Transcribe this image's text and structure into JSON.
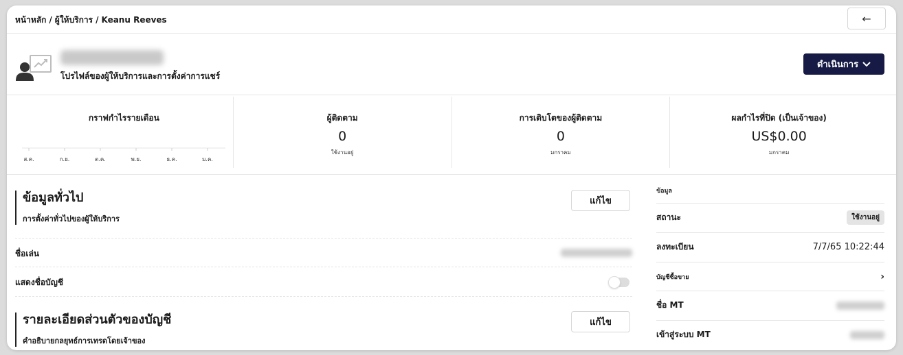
{
  "breadcrumb": {
    "home": "หน้าหลัก",
    "providers": "ผู้ให้บริการ",
    "current": "Keanu Reeves",
    "separator": "/"
  },
  "header": {
    "back_icon": "←"
  },
  "profile": {
    "subtitle": "โปรไฟล์ของผู้ให้บริการและการตั้งค่าการแชร์",
    "action_label": "ดำเนินการ",
    "action_chevron": "⌄"
  },
  "stats": {
    "monthly_chart": {
      "title": "กราฟกำไรรายเดือน",
      "months": [
        "ส.ค.",
        "ก.ย.",
        "ต.ค.",
        "พ.ย.",
        "ธ.ค.",
        "ม.ค."
      ]
    },
    "followers": {
      "title": "ผู้ติดตาม",
      "value": "0",
      "sub": "ใช้งานอยู่"
    },
    "growth": {
      "title": "การเติบโตของผู้ติดตาม",
      "value": "0",
      "sub": "มกราคม"
    },
    "closed_profit": {
      "title": "ผลกำไรที่ปิด (เป็นเจ้าของ)",
      "value": "US$0.00",
      "sub": "มกราคม"
    }
  },
  "general": {
    "title": "ข้อมูลทั่วไป",
    "desc": "การตั้งค่าทั่วไปของผู้ให้บริการ",
    "edit_label": "แก้ไข",
    "nickname_label": "ชื่อเล่น",
    "show_account_label": "แสดงชื่อบัญชี"
  },
  "account_details": {
    "title": "รายละเอียดส่วนตัวของบัญชี",
    "desc": "คำอธิบายกลยุทธ์การเทรดโดยเจ้าของ",
    "edit_label": "แก้ไข"
  },
  "info_panel": {
    "heading": "ข้อมูล",
    "status_label": "สถานะ",
    "status_value": "ใช้งานอยู่",
    "registered_label": "ลงทะเบียน",
    "registered_value": "7/7/65 10:22:44",
    "seller_account_label": "บัญชีซื้อขาย",
    "seller_chevron": "›",
    "mt_name_label": "ชื่อ MT",
    "mt_login_label": "เข้าสู่ระบบ MT"
  },
  "colors": {
    "primary_button": "#171a44",
    "badge_bg": "#e4e4e4"
  }
}
